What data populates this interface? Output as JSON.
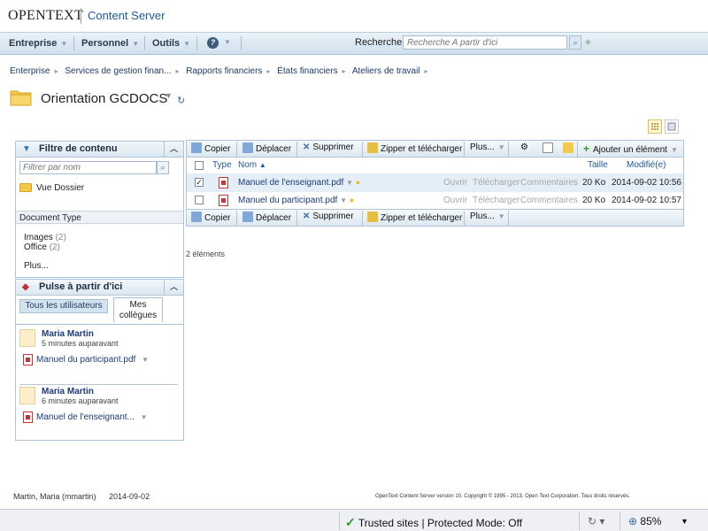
{
  "header": {
    "brand": "OPENTEXT",
    "product": "Content Server"
  },
  "nav": {
    "items": [
      "Entreprise",
      "Personnel",
      "Outils"
    ],
    "help_icon": "help-icon",
    "search_label": "Rechercher",
    "search_placeholder": "Recherche A partir d'ici"
  },
  "breadcrumb": [
    "Enterprise",
    "Services de gestion finan...",
    "Rapports financiers",
    "États financiers",
    "Ateliers de travail"
  ],
  "page": {
    "title": "Orientation GCDOCS"
  },
  "filter_panel": {
    "title": "Filtre de contenu",
    "placeholder": "Filtrer par nom",
    "folder_item": "Vue Dossier",
    "section_title": "Document Type",
    "types": [
      {
        "label": "Images",
        "count": "(2)"
      },
      {
        "label": "Office",
        "count": "(2)"
      }
    ],
    "more": "Plus..."
  },
  "pulse_panel": {
    "title": "Pulse à partir d'ici",
    "tab_all": "Tous les utilisateurs",
    "tab_colleagues_1": "Mes",
    "tab_colleagues_2": "collègues",
    "entries": [
      {
        "name": "Maria Martin",
        "time": "5 minutes auparavant",
        "doc": "Manuel du participant.pdf"
      },
      {
        "name": "Maria Martin",
        "time": "6 minutes auparavant",
        "doc": "Manuel de l'enseignant..."
      }
    ]
  },
  "toolbar": {
    "copy": "Copier",
    "move": "Déplacer",
    "delete": "Supprimer",
    "zip": "Zipper et télécharger",
    "more": "Plus...",
    "add_item": "Ajouter un élément"
  },
  "table": {
    "columns": {
      "type": "Type",
      "name": "Nom",
      "size": "Taille",
      "modified": "Modifié(e)"
    },
    "actions": {
      "open": "Ouvrir",
      "download": "Télécharger",
      "comments": "Commentaires"
    },
    "rows": [
      {
        "name": "Manuel de l'enseignant.pdf",
        "size": "20 Ko",
        "modified": "2014-09-02 10:56",
        "checked": true
      },
      {
        "name": "Manuel du participant.pdf",
        "size": "20 Ko",
        "modified": "2014-09-02 10:57",
        "checked": false
      }
    ],
    "count_label": "2 éléments"
  },
  "footer": {
    "user": "Martin, Maria (mmartin)",
    "date": "2014-09-02",
    "copyright": "OpenText Content Server version 10. Copyright © 1995 - 2013, Open Text Corporation. Tous droits réservés."
  },
  "statusbar": {
    "zone": "Trusted sites | Protected Mode: Off",
    "zoom": "85%"
  },
  "colors": {
    "link": "#1a3a7a",
    "accent": "#1d5aa0",
    "folder": "#f5c94a",
    "panel_border": "#b0c4d8"
  }
}
